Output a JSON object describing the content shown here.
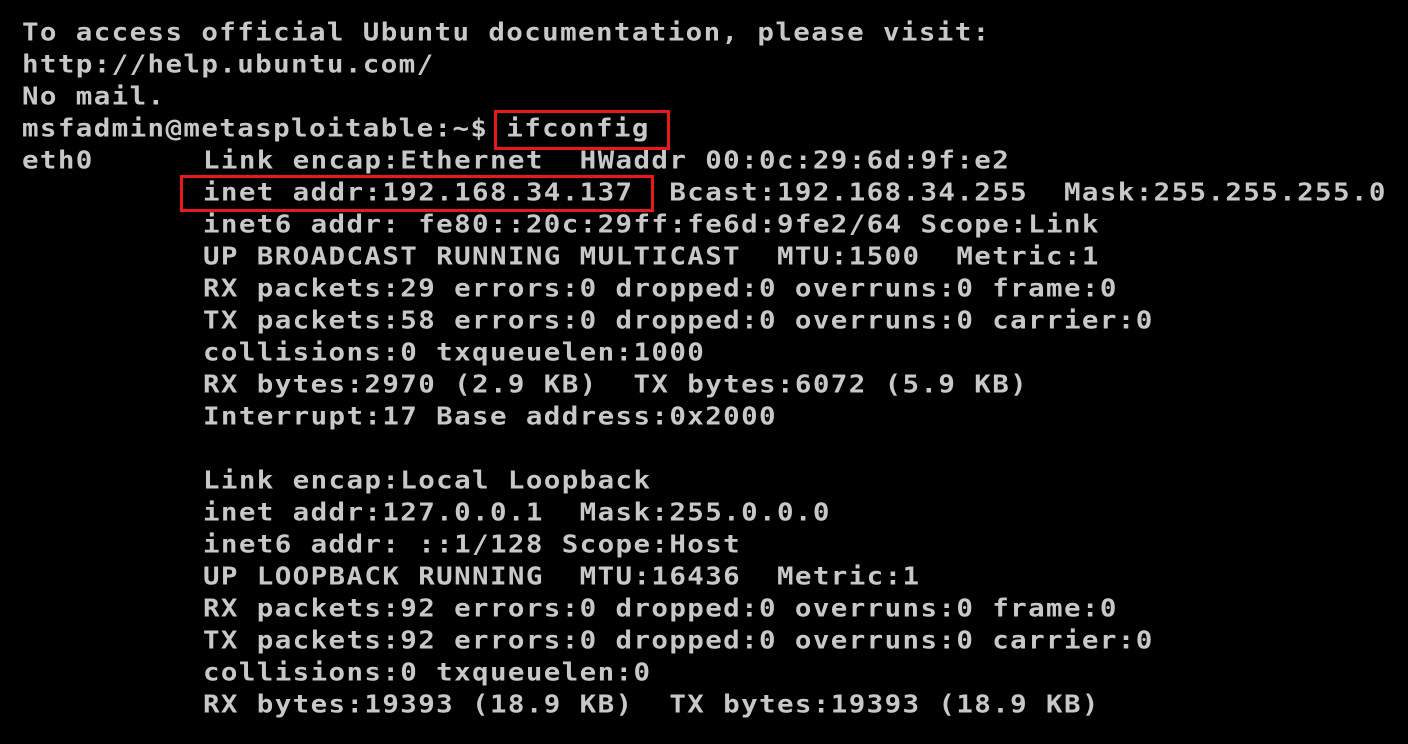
{
  "terminal": {
    "header_lines": [
      "To access official Ubuntu documentation, please visit:",
      "http://help.ubuntu.com/",
      "No mail."
    ],
    "prompt": "msfadmin@metasploitable:~$",
    "command": "ifconfig",
    "interfaces": [
      {
        "name": "eth0",
        "lines": [
          "Link encap:Ethernet  HWaddr 00:0c:29:6d:9f:e2",
          "inet addr:192.168.34.137  Bcast:192.168.34.255  Mask:255.255.255.0",
          "inet6 addr: fe80::20c:29ff:fe6d:9fe2/64 Scope:Link",
          "UP BROADCAST RUNNING MULTICAST  MTU:1500  Metric:1",
          "RX packets:29 errors:0 dropped:0 overruns:0 frame:0",
          "TX packets:58 errors:0 dropped:0 overruns:0 carrier:0",
          "collisions:0 txqueuelen:1000",
          "RX bytes:2970 (2.9 KB)  TX bytes:6072 (5.9 KB)",
          "Interrupt:17 Base address:0x2000"
        ]
      },
      {
        "name": "",
        "lines": [
          "Link encap:Local Loopback",
          "inet addr:127.0.0.1  Mask:255.0.0.0",
          "inet6 addr: ::1/128 Scope:Host",
          "UP LOOPBACK RUNNING  MTU:16436  Metric:1",
          "RX packets:92 errors:0 dropped:0 overruns:0 frame:0",
          "TX packets:92 errors:0 dropped:0 overruns:0 carrier:0",
          "collisions:0 txqueuelen:0",
          "RX bytes:19393 (18.9 KB)  TX bytes:19393 (18.9 KB)"
        ]
      }
    ]
  },
  "colors": {
    "background": "#000000",
    "text": "#c8c8c8",
    "highlight": "#e8191b"
  }
}
